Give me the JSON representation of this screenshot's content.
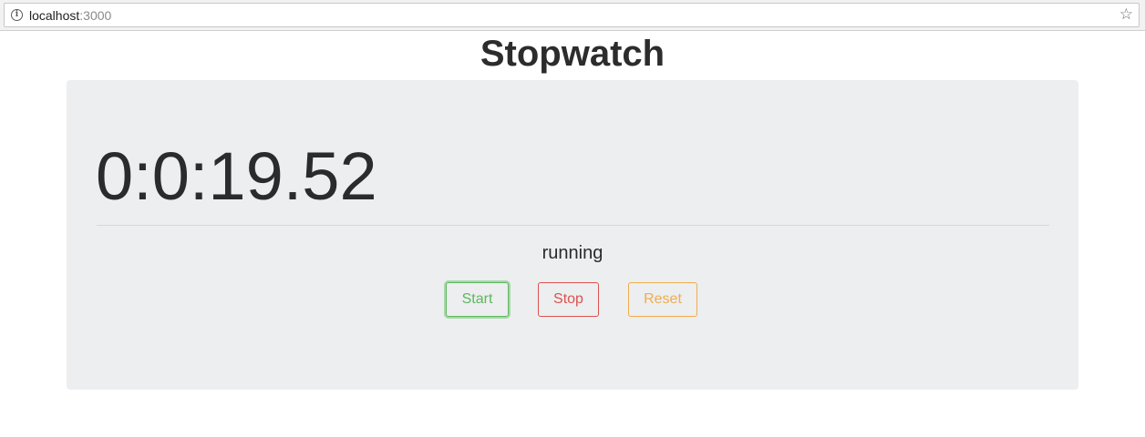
{
  "browser": {
    "url_host": "localhost",
    "url_port": ":3000",
    "info_icon": "info-icon",
    "bookmark_icon": "star-icon"
  },
  "page": {
    "title": "Stopwatch"
  },
  "stopwatch": {
    "time": "0:0:19.52",
    "status": "running"
  },
  "controls": {
    "start_label": "Start",
    "stop_label": "Stop",
    "reset_label": "Reset"
  },
  "colors": {
    "start": "#5cb85c",
    "stop": "#d9534f",
    "reset": "#f0ad4e",
    "panel_background": "#eceeef"
  }
}
